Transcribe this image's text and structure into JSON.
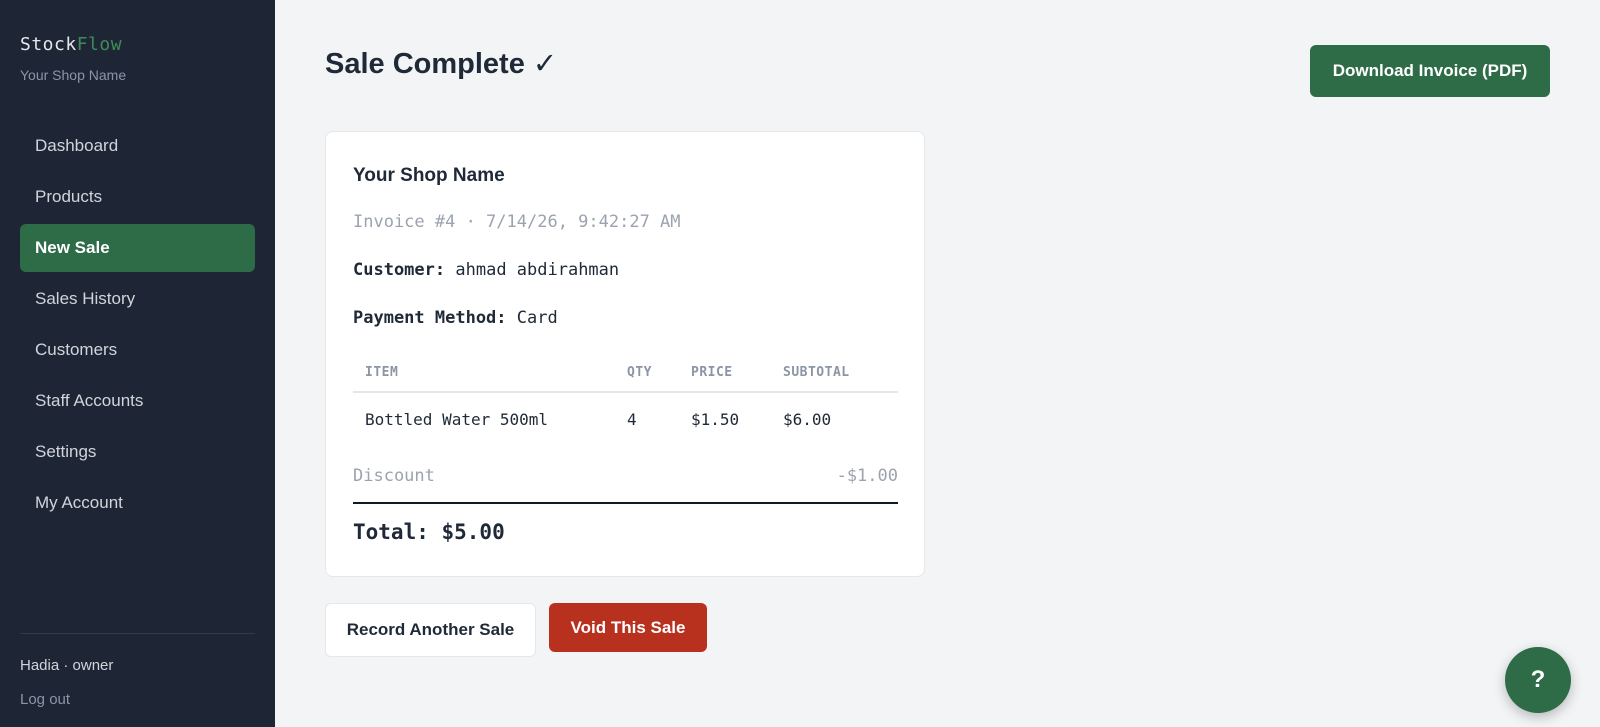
{
  "sidebar": {
    "brand_part1": "Stock",
    "brand_part2": "Flow",
    "shop_name": "Your Shop Name",
    "nav": [
      {
        "label": "Dashboard",
        "active": false
      },
      {
        "label": "Products",
        "active": false
      },
      {
        "label": "New Sale",
        "active": true
      },
      {
        "label": "Sales History",
        "active": false
      },
      {
        "label": "Customers",
        "active": false
      },
      {
        "label": "Staff Accounts",
        "active": false
      },
      {
        "label": "Settings",
        "active": false
      },
      {
        "label": "My Account",
        "active": false
      }
    ],
    "user": "Hadia · owner",
    "logout": "Log out"
  },
  "header": {
    "title": "Sale Complete ✓",
    "download_label": "Download Invoice (PDF)"
  },
  "receipt": {
    "shop_name": "Your Shop Name",
    "invoice_line": "Invoice #4 · 7/14/26, 9:42:27 AM",
    "customer_label": "Customer:",
    "customer_value": "ahmad abdirahman",
    "payment_label": "Payment Method:",
    "payment_value": "Card",
    "columns": [
      "ITEM",
      "QTY",
      "PRICE",
      "SUBTOTAL"
    ],
    "items": [
      {
        "item": "Bottled Water 500ml",
        "qty": "4",
        "price": "$1.50",
        "subtotal": "$6.00"
      }
    ],
    "discount_label": "Discount",
    "discount_value": "-$1.00",
    "total": "Total: $5.00"
  },
  "actions": {
    "record_another": "Record Another Sale",
    "void": "Void This Sale"
  },
  "help": {
    "label": "?"
  },
  "colors": {
    "sidebar_bg": "#1e2636",
    "accent_green": "#2e6b47",
    "danger_red": "#b8311f",
    "page_bg": "#f3f4f6"
  }
}
